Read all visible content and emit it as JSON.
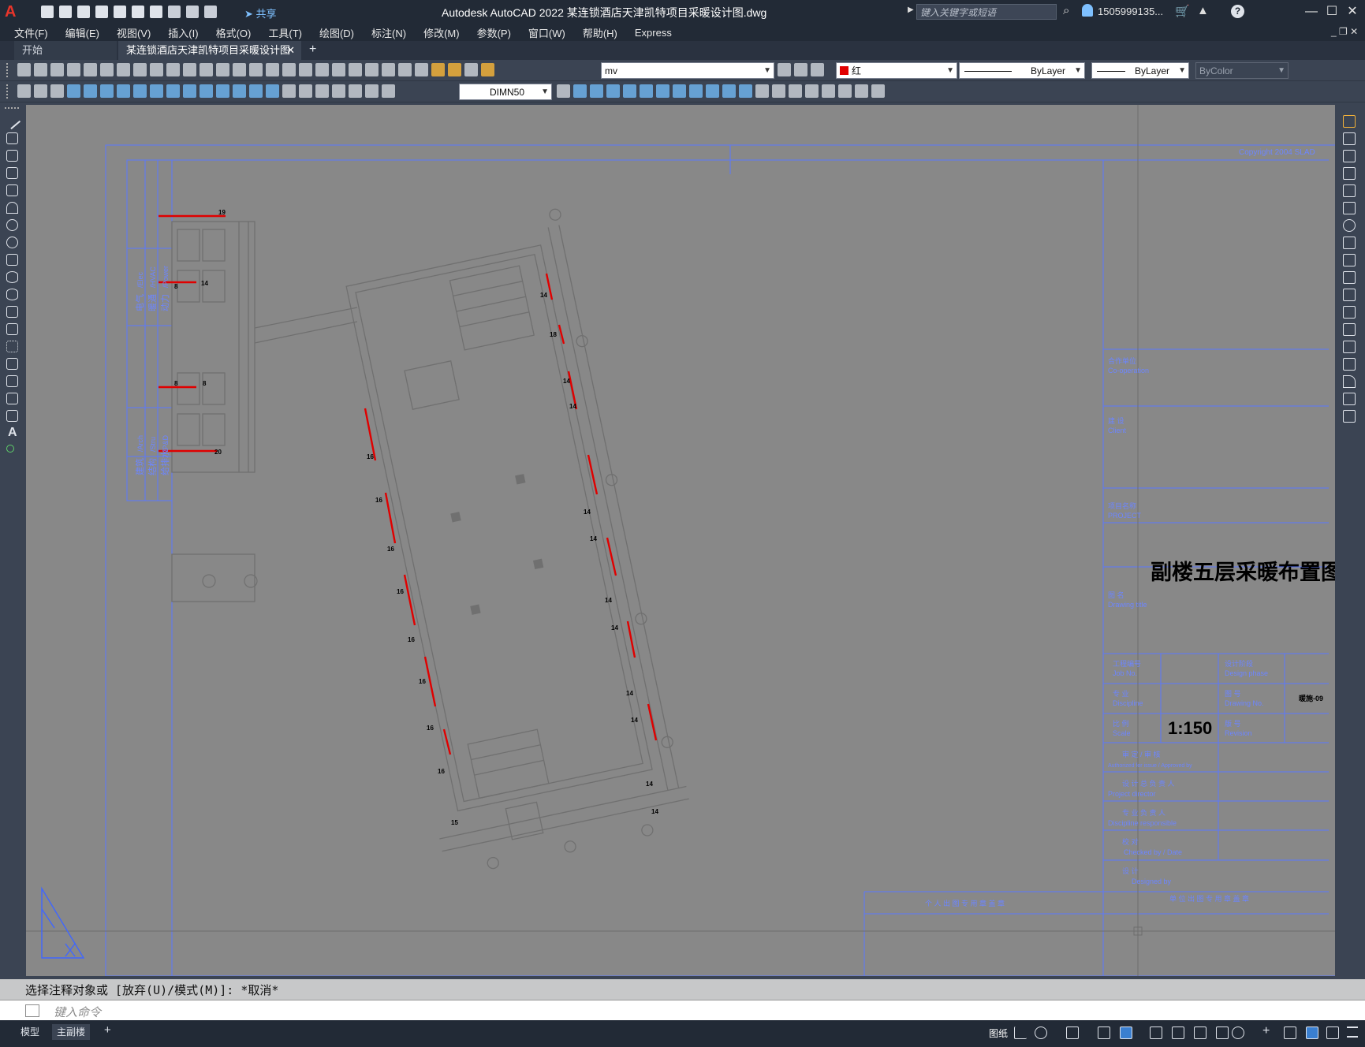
{
  "app": {
    "logo": "A",
    "title": "Autodesk AutoCAD 2022    某连锁酒店天津凯特项目采暖设计图.dwg",
    "share_label": "共享",
    "search_placeholder": "键入关键字或短语",
    "user": "1505999135...",
    "help": "?"
  },
  "menu": [
    "文件(F)",
    "编辑(E)",
    "视图(V)",
    "插入(I)",
    "格式(O)",
    "工具(T)",
    "绘图(D)",
    "标注(N)",
    "修改(M)",
    "参数(P)",
    "窗口(W)",
    "帮助(H)",
    "Express"
  ],
  "tabs": {
    "start": "开始",
    "drawing": "某连锁酒店天津凯特项目采暖设计图*",
    "close": "✕",
    "add": "+"
  },
  "toolbar": {
    "layer": "mv",
    "color": "红",
    "linetype": "ByLayer",
    "lineweight": "ByLayer",
    "plotstyle": "ByColor",
    "dimstyle": "DIMN50"
  },
  "drawing": {
    "copyright": "Copyright 2004 SLAD",
    "title_block": {
      "cooperation_cn": "合作单位",
      "cooperation_en": "Co-operation",
      "client_cn": "建 设",
      "client_en": "Client",
      "project_cn": "项目名称",
      "project_en": "PROJECT",
      "drawing_title_cn": "图 名",
      "drawing_title_en": "Drawing title",
      "drawing_title": "副楼五层采暖布置图",
      "job_no_cn": "工程编号",
      "job_no_en": "Job No.",
      "design_phase_cn": "设计阶段",
      "design_phase_en": "Design phase",
      "discipline_cn": "专 业",
      "discipline_en": "Discipline",
      "drawing_no_cn": "图 号",
      "drawing_no_en": "Drawing No.",
      "drawing_no": "暖施-09",
      "scale_cn": "比 例",
      "scale_en": "Scale",
      "scale": "1:150",
      "revision_cn": "版 号",
      "revision_en": "Revision",
      "approve_cn": "审 定 / 审 核",
      "approve_en": "Authorized for issue / Approved by",
      "director_cn": "设 计 总 负 责 人",
      "director_en": "Project director",
      "disc_resp_cn": "专 业 负 责 人",
      "disc_resp_en": "Discipline responsible",
      "checked_cn": "校 对",
      "checked_en": "Checked by / Date",
      "designed_cn": "设 计",
      "designed_en": "Designed by",
      "stamp_personal": "个 人 出 图 专 用 章 盖 章",
      "stamp_unit": "单 位 出 图 专 用 章 盖 章"
    },
    "side_stamp": [
      "电气",
      "暖通",
      "动力",
      "建筑",
      "结构",
      "给排水"
    ],
    "side_stamp_en": [
      "/Elec",
      "/HVAC",
      "/Power",
      "/Arch",
      "/Stru",
      "/P&D"
    ],
    "radiator_labels": [
      "19",
      "8",
      "14",
      "8",
      "8",
      "20",
      "14",
      "18",
      "14",
      "14",
      "14",
      "14",
      "14",
      "14",
      "14",
      "14",
      "14",
      "14",
      "16",
      "16",
      "16",
      "16",
      "16",
      "16",
      "16",
      "16",
      "15"
    ]
  },
  "command": {
    "history": "选择注释对象或 [放弃(U)/模式(M)]: *取消*",
    "placeholder": "键入命令"
  },
  "status": {
    "model_tab": "模型",
    "layout_tab": "主副楼",
    "add": "+",
    "paper": "图纸"
  }
}
